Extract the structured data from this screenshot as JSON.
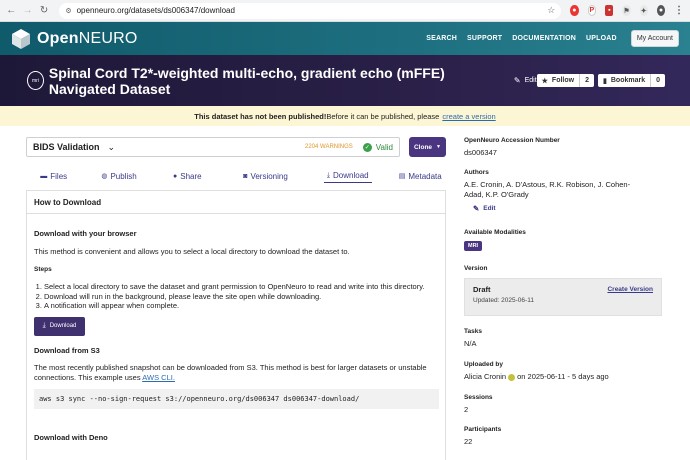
{
  "browser": {
    "url": "openneuro.org/datasets/ds006347/download"
  },
  "header": {
    "logo_open": "Open",
    "logo_neuro": "NEURO",
    "nav": [
      "SEARCH",
      "SUPPORT",
      "DOCUMENTATION",
      "UPLOAD"
    ],
    "account_label": "My Account"
  },
  "dataset": {
    "modality_badge": "mri",
    "title": "Spinal Cord T2*-weighted multi-echo, gradient echo (mFFE) Navigated Dataset",
    "edit_label": "Edit",
    "follow_label": "Follow",
    "follow_count": "2",
    "bookmark_label": "Bookmark",
    "bookmark_count": "0"
  },
  "notice": {
    "bold": "This dataset has not been published!",
    "text": " Before it can be published, please",
    "link": "create a version"
  },
  "validation": {
    "label": "BIDS Validation",
    "warnings": "2204 WARNINGS",
    "status": "Valid",
    "clone_label": "Clone"
  },
  "tabs": [
    {
      "label": "Files",
      "icon": "folder-icon"
    },
    {
      "label": "Publish",
      "icon": "globe-icon"
    },
    {
      "label": "Share",
      "icon": "user-icon"
    },
    {
      "label": "Versioning",
      "icon": "camera-icon"
    },
    {
      "label": "Download",
      "icon": "download-icon"
    },
    {
      "label": "Metadata",
      "icon": "file-icon"
    }
  ],
  "download": {
    "heading": "How to Download",
    "browser_heading": "Download with your browser",
    "browser_text": "This method is convenient and allows you to select a local directory to download the dataset to.",
    "steps_heading": "Steps",
    "steps": [
      "Select a local directory to save the dataset and grant permission to OpenNeuro to read and write into this directory.",
      "Download will run in the background, please leave the site open while downloading.",
      "A notification will appear when complete."
    ],
    "button_label": "Download",
    "s3_heading": "Download from S3",
    "s3_text": "The most recently published snapshot can be downloaded from S3. This method is best for larger datasets or unstable connections. This example uses",
    "s3_link": "AWS CLI.",
    "s3_command": "aws s3 sync --no-sign-request s3://openneuro.org/ds006347 ds006347-download/",
    "deno_heading": "Download with Deno"
  },
  "sidebar": {
    "accession_label": "OpenNeuro Accession Number",
    "accession_value": "ds006347",
    "authors_label": "Authors",
    "authors_value": "A.E. Cronin, A. D'Astous, R.K. Robison, J. Cohen-Adad, K.P. O'Grady",
    "authors_edit": "Edit",
    "modalities_label": "Available Modalities",
    "modality_value": "MRI",
    "version_label": "Version",
    "version_draft": "Draft",
    "version_updated": "Updated: 2025-06-11",
    "create_version": "Create Version",
    "tasks_label": "Tasks",
    "tasks_value": "N/A",
    "uploaded_label": "Uploaded by",
    "uploaded_user": "Alicia Cronin",
    "uploaded_when": "on 2025-06-11 - 5 days ago",
    "sessions_label": "Sessions",
    "sessions_value": "2",
    "participants_label": "Participants",
    "participants_value": "22"
  }
}
